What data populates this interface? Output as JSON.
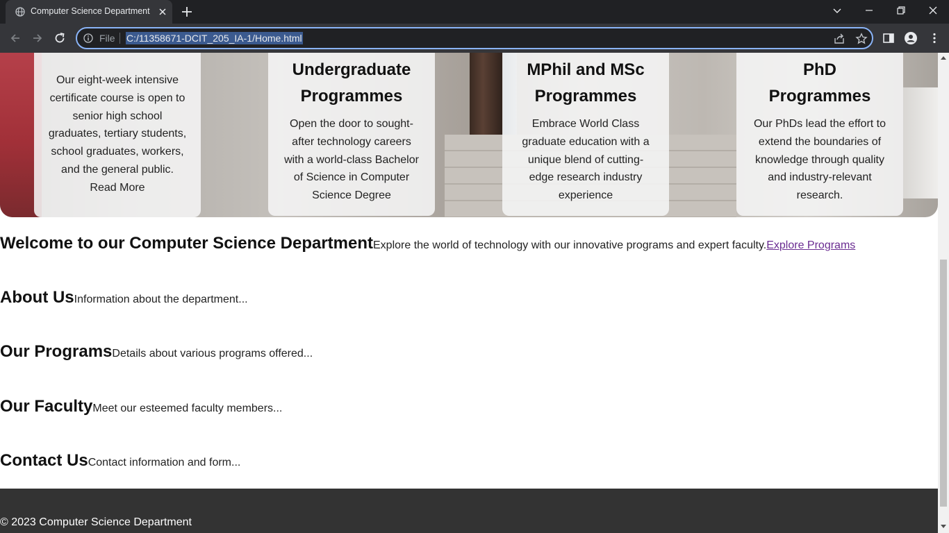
{
  "browser": {
    "tab_title": "Computer Science Department",
    "scheme_label": "File",
    "url": "C:/11358671-DCIT_205_IA-1/Home.html",
    "accent": "#8ab4f8"
  },
  "hero": {
    "cards": [
      {
        "heading": "",
        "text": "Our eight-week intensive certificate course is open to senior high school graduates, tertiary students, school graduates, workers, and the general public.",
        "link": "Read More"
      },
      {
        "heading": "Undergraduate Programmes",
        "text": "Open the door to sought-after technology careers with a world-class Bachelor of Science in Computer Science Degree",
        "link": ""
      },
      {
        "heading": "MPhil and MSc Programmes",
        "text": "Embrace World Class graduate education with a unique blend of cutting-edge research industry experience",
        "link": ""
      },
      {
        "heading": "PhD Programmes",
        "text": "Our PhDs lead the effort to extend the boundaries of knowledge through quality and industry-relevant research.",
        "link": ""
      }
    ]
  },
  "sections": {
    "welcome": {
      "heading": "Welcome to our Computer Science Department",
      "text": "Explore the world of technology with our innovative programs and expert faculty.",
      "link": "Explore Programs",
      "link_color": "#6a2c91"
    },
    "about": {
      "heading": "About Us",
      "text": "Information about the department..."
    },
    "programs": {
      "heading": "Our Programs",
      "text": "Details about various programs offered..."
    },
    "faculty": {
      "heading": "Our Faculty",
      "text": "Meet our esteemed faculty members..."
    },
    "contact": {
      "heading": "Contact Us",
      "text": "Contact information and form..."
    }
  },
  "footer": {
    "text": "© 2023 Computer Science Department",
    "background": "#333333"
  }
}
